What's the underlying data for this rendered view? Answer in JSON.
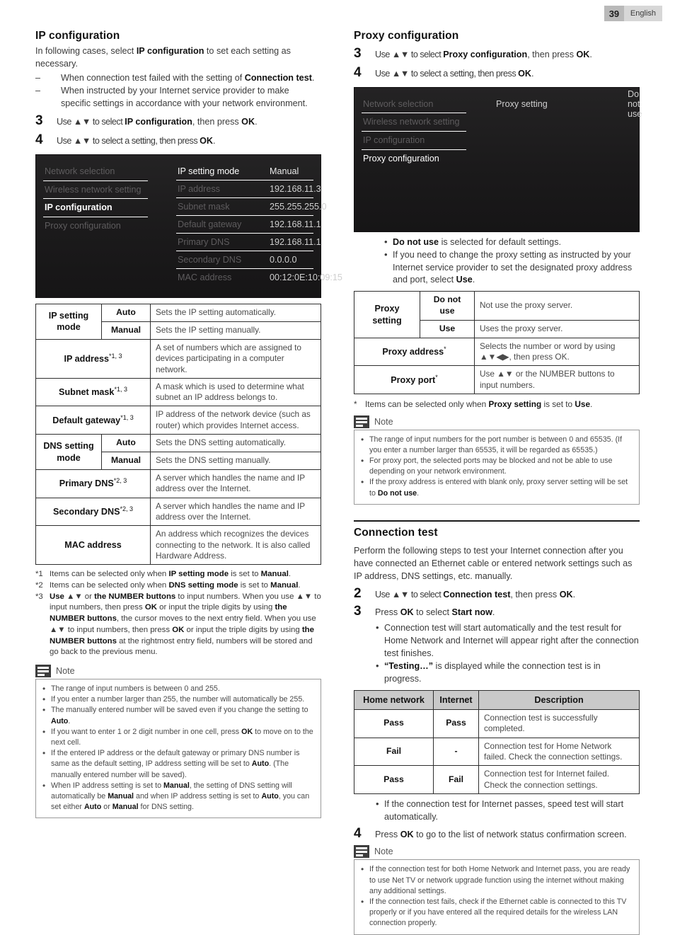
{
  "header": {
    "page_number": "39",
    "language": "English"
  },
  "left": {
    "title": "IP configuration",
    "intro": "In following cases, select ",
    "intro_bold": "IP configuration",
    "intro_tail": " to set each setting as necessary.",
    "dash_items": [
      {
        "pre": "When connection test failed with the setting of ",
        "bold": "Connection test",
        "post": "."
      },
      {
        "pre": "When instructed by your Internet service provider to make specific settings in accordance with your network environment.",
        "bold": "",
        "post": ""
      }
    ],
    "steps": [
      {
        "num": "3",
        "pre": "Use ▲▼ to select ",
        "bold": "IP configuration",
        "mid": ", then press ",
        "bold2": "OK",
        "post": "."
      },
      {
        "num": "4",
        "pre": "Use ▲▼ to select a setting, then press ",
        "bold": "",
        "mid": "",
        "bold2": "OK",
        "post": "."
      }
    ],
    "tv": {
      "nav": [
        {
          "label": "Network selection",
          "state": "dim"
        },
        {
          "label": "Wireless network setting",
          "state": "dim"
        },
        {
          "label": "IP configuration",
          "state": "active"
        },
        {
          "label": "Proxy configuration",
          "state": "dim"
        }
      ],
      "rows": [
        {
          "key": "IP setting mode",
          "value": "Manual"
        },
        {
          "key": "IP address",
          "value": "192.168.11.3"
        },
        {
          "key": "Subnet mask",
          "value": "255.255.255.0"
        },
        {
          "key": "Default gateway",
          "value": "192.168.11.1"
        },
        {
          "key": "Primary DNS",
          "value": "192.168.11.1"
        },
        {
          "key": "Secondary DNS",
          "value": "0.0.0.0"
        },
        {
          "key": "MAC address",
          "value": "00:12:0E:10:09:15"
        }
      ]
    },
    "table": {
      "rows": [
        {
          "label": "IP setting mode",
          "sup": "",
          "option": "Auto",
          "desc": "Sets the IP setting automatically."
        },
        {
          "label": "",
          "sup": "",
          "option": "Manual",
          "desc": "Sets the IP setting manually."
        },
        {
          "label": "IP address",
          "sup": "*1, 3",
          "option": null,
          "desc": "A set of numbers which are assigned to devices participating in a computer network."
        },
        {
          "label": "Subnet mask",
          "sup": "*1, 3",
          "option": null,
          "desc": "A mask which is used to determine what subnet an IP address belongs to."
        },
        {
          "label": "Default gateway",
          "sup": "*1, 3",
          "option": null,
          "desc": "IP address of the network device (such as router) which provides Internet access."
        },
        {
          "label": "DNS setting mode",
          "sup": "",
          "option": "Auto",
          "desc": "Sets the DNS setting automatically."
        },
        {
          "label": "",
          "sup": "",
          "option": "Manual",
          "desc": "Sets the DNS setting manually."
        },
        {
          "label": "Primary DNS",
          "sup": "*2, 3",
          "option": null,
          "desc": "A server which handles the name and IP address over the Internet."
        },
        {
          "label": "Secondary DNS",
          "sup": "*2, 3",
          "option": null,
          "desc": "A server which handles the name and IP address over the Internet."
        },
        {
          "label": "MAC address",
          "sup": "",
          "option": null,
          "desc": "An address which recognizes the devices connecting to the network. It is also called Hardware Address."
        }
      ]
    },
    "footnotes": [
      {
        "mark": "*1",
        "text": "Items can be selected only when IP setting mode is set to Manual."
      },
      {
        "mark": "*2",
        "text": "Items can be selected only when DNS setting mode is set to Manual."
      },
      {
        "mark": "*3",
        "text": "Use ▲▼ or the NUMBER buttons to input numbers. When you use ▲▼ to input numbers, then press OK or input the triple digits by using the NUMBER buttons, the cursor moves to the next entry field. When you use ▲▼ to input numbers, then press OK or input the triple digits by using the NUMBER buttons at the rightmost entry field, numbers will be stored and go back to the previous menu."
      }
    ],
    "note": {
      "title": "Note",
      "items": [
        "The range of input numbers is between 0 and 255.",
        "If you enter a number larger than 255, the number will automatically be 255.",
        "The manually entered number will be saved even if you change the setting to Auto.",
        "If you want to enter 1 or 2 digit number in one cell, press OK to move on to the next cell.",
        "If the entered IP address or the default gateway or primary DNS number is same as the default setting, IP address setting will be set to Auto. (The manually entered number will be saved).",
        "When IP address setting is set to Manual, the setting of DNS setting will automatically be Manual and when IP address setting is set to Auto, you can set either Auto or Manual for DNS setting."
      ]
    }
  },
  "right": {
    "title": "Proxy configuration",
    "steps": [
      {
        "num": "3",
        "pre": "Use ▲▼ to select ",
        "bold": "Proxy configuration",
        "mid": ", then press ",
        "bold2": "OK",
        "post": "."
      },
      {
        "num": "4",
        "pre": "Use ▲▼ to select a setting, then press ",
        "bold": "",
        "mid": "",
        "bold2": "OK",
        "post": "."
      }
    ],
    "tv": {
      "nav": [
        {
          "label": "Network selection",
          "state": "dim"
        },
        {
          "label": "Wireless network setting",
          "state": "dim"
        },
        {
          "label": "IP configuration",
          "state": "dim"
        },
        {
          "label": "Proxy configuration",
          "state": "bright"
        }
      ],
      "rows": [
        {
          "key": "Proxy setting",
          "value": "Do not use"
        }
      ]
    },
    "bullets": [
      {
        "bold": "Do not use",
        "text": " is selected for default settings."
      },
      {
        "bold": "",
        "text": "If you need to change the proxy setting as instructed by your Internet service provider to set the designated proxy address and port, select Use."
      }
    ],
    "table": {
      "rows": [
        {
          "label": "Proxy setting",
          "sup": "",
          "option": "Do not use",
          "desc": "Not use the proxy server."
        },
        {
          "label": "",
          "sup": "",
          "option": "Use",
          "desc": "Uses the proxy server."
        },
        {
          "label": "Proxy address",
          "sup": "*",
          "option": null,
          "desc": "Selects the number or word by using ▲▼◀▶, then press OK."
        },
        {
          "label": "Proxy port",
          "sup": "*",
          "option": null,
          "desc": "Use ▲▼ or the NUMBER buttons to input numbers."
        }
      ]
    },
    "footnote": {
      "mark": "*",
      "text": "Items can be selected only when Proxy setting is set to Use."
    },
    "note1": {
      "title": "Note",
      "items": [
        "The range of input numbers for the port number is between 0 and 65535. (If you enter a number larger than 65535, it will be regarded as 65535.)",
        "For proxy port, the selected ports may be blocked and not be able to use depending on your network environment.",
        "If the proxy address is entered with blank only, proxy server setting will be set to Do not use."
      ]
    },
    "conn_title": "Connection test",
    "conn_intro": "Perform the following steps to test your Internet connection after you have connected an Ethernet cable or entered network settings such as IP address, DNS settings, etc. manually.",
    "conn_steps": [
      {
        "num": "2",
        "pre": "Use ▲▼ to select ",
        "bold": "Connection test",
        "mid": ", then press ",
        "bold2": "OK",
        "post": "."
      },
      {
        "num": "3",
        "pre": "Press ",
        "bold2": "OK",
        "mid": " to select ",
        "bold": "Start now",
        "post": "."
      }
    ],
    "conn_bullets": [
      "Connection test will start automatically and the test result for Home Network and Internet will appear right after the connection test finishes.",
      "“Testing…” is displayed while the connection test is in progress."
    ],
    "result_table": {
      "headers": [
        "Home network",
        "Internet",
        "Description"
      ],
      "rows": [
        {
          "home": "Pass",
          "internet": "Pass",
          "desc": "Connection test is successfully completed."
        },
        {
          "home": "Fail",
          "internet": "-",
          "desc": "Connection test for Home Network failed. Check the connection settings."
        },
        {
          "home": "Pass",
          "internet": "Fail",
          "desc": "Connection test for Internet failed. Check the connection settings."
        }
      ]
    },
    "after_table_bullet": "If the connection test for Internet passes, speed test will start automatically.",
    "final_step": {
      "num": "4",
      "pre": "Press ",
      "bold2": "OK",
      "post": " to go to the list of network status confirmation screen."
    },
    "note2": {
      "title": "Note",
      "items": [
        "If the connection test for both Home Network and Internet pass,  you are ready to use Net TV or network upgrade function using the internet without making any additional settings.",
        "If the connection test fails, check if the Ethernet cable is connected to this TV properly or if you have entered all the required details for the wireless LAN connection properly."
      ]
    }
  }
}
